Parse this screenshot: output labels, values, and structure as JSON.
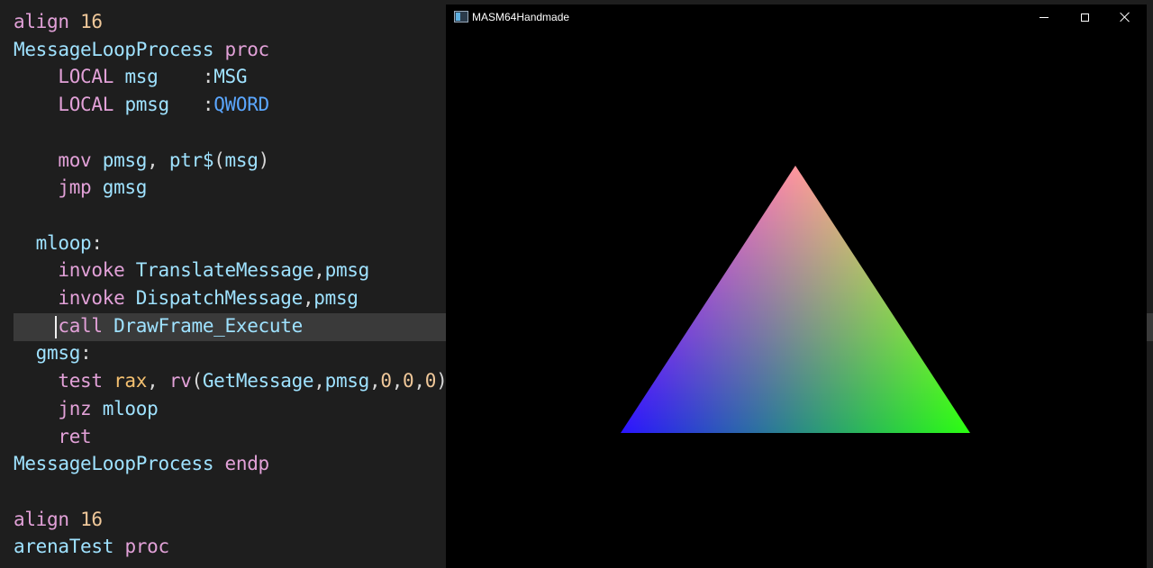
{
  "editor": {
    "lines": [
      [
        {
          "t": "align ",
          "c": "kw"
        },
        {
          "t": "16",
          "c": "num"
        }
      ],
      [
        {
          "t": "MessageLoopProcess ",
          "c": "id"
        },
        {
          "t": "proc",
          "c": "kw"
        }
      ],
      [
        {
          "t": "    LOCAL ",
          "c": "kw"
        },
        {
          "t": "msg    ",
          "c": "id"
        },
        {
          "t": ":",
          "c": "pun"
        },
        {
          "t": "MSG",
          "c": "id"
        }
      ],
      [
        {
          "t": "    LOCAL ",
          "c": "kw"
        },
        {
          "t": "pmsg   ",
          "c": "id"
        },
        {
          "t": ":",
          "c": "pun"
        },
        {
          "t": "QWORD",
          "c": "typ"
        }
      ],
      [],
      [
        {
          "t": "    mov ",
          "c": "kw"
        },
        {
          "t": "pmsg",
          "c": "id"
        },
        {
          "t": ", ",
          "c": "pun"
        },
        {
          "t": "ptr$",
          "c": "id"
        },
        {
          "t": "(",
          "c": "pun"
        },
        {
          "t": "msg",
          "c": "id"
        },
        {
          "t": ")",
          "c": "pun"
        }
      ],
      [
        {
          "t": "    jmp ",
          "c": "kw"
        },
        {
          "t": "gmsg",
          "c": "id"
        }
      ],
      [],
      [
        {
          "t": "  mloop",
          "c": "id"
        },
        {
          "t": ":",
          "c": "pun"
        }
      ],
      [
        {
          "t": "    invoke ",
          "c": "kw"
        },
        {
          "t": "TranslateMessage",
          "c": "id"
        },
        {
          "t": ",",
          "c": "pun"
        },
        {
          "t": "pmsg",
          "c": "id"
        }
      ],
      [
        {
          "t": "    invoke ",
          "c": "kw"
        },
        {
          "t": "DispatchMessage",
          "c": "id"
        },
        {
          "t": ",",
          "c": "pun"
        },
        {
          "t": "pmsg",
          "c": "id"
        }
      ],
      [
        {
          "t": "    call ",
          "c": "kw"
        },
        {
          "t": "DrawFrame_Execute",
          "c": "id"
        }
      ],
      [
        {
          "t": "  gmsg",
          "c": "id"
        },
        {
          "t": ":",
          "c": "pun"
        }
      ],
      [
        {
          "t": "    test ",
          "c": "kw"
        },
        {
          "t": "rax",
          "c": "reg"
        },
        {
          "t": ", ",
          "c": "pun"
        },
        {
          "t": "rv",
          "c": "kw"
        },
        {
          "t": "(",
          "c": "pun"
        },
        {
          "t": "GetMessage",
          "c": "id"
        },
        {
          "t": ",",
          "c": "pun"
        },
        {
          "t": "pmsg",
          "c": "id"
        },
        {
          "t": ",",
          "c": "pun"
        },
        {
          "t": "0",
          "c": "num"
        },
        {
          "t": ",",
          "c": "pun"
        },
        {
          "t": "0",
          "c": "num"
        },
        {
          "t": ",",
          "c": "pun"
        },
        {
          "t": "0",
          "c": "num"
        },
        {
          "t": ")",
          "c": "pun"
        }
      ],
      [
        {
          "t": "    jnz ",
          "c": "kw"
        },
        {
          "t": "mloop",
          "c": "id"
        }
      ],
      [
        {
          "t": "    ret",
          "c": "kw"
        }
      ],
      [
        {
          "t": "MessageLoopProcess ",
          "c": "id"
        },
        {
          "t": "endp",
          "c": "kw"
        }
      ],
      [],
      [
        {
          "t": "align ",
          "c": "kw"
        },
        {
          "t": "16",
          "c": "num"
        }
      ],
      [
        {
          "t": "arenaTest ",
          "c": "id"
        },
        {
          "t": "proc",
          "c": "kw"
        }
      ]
    ],
    "current_line": 11
  },
  "window": {
    "title": "MASM64Handmade",
    "app_icon": "window-app-icon",
    "controls": {
      "minimize": "minimize-icon",
      "maximize": "maximize-icon",
      "close": "close-icon"
    }
  },
  "scene": {
    "shape": "triangle",
    "vertex_colors": [
      "#ff1a2e",
      "#2a14ff",
      "#2aff10"
    ]
  }
}
